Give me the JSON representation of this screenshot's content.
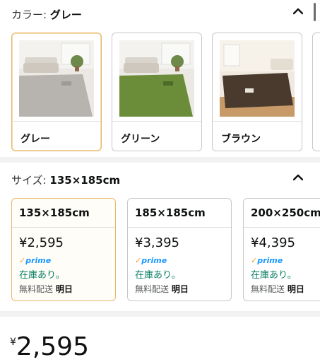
{
  "color_section": {
    "label": "カラー:",
    "selected_value": "グレー",
    "options": [
      {
        "label": "グレー",
        "rug_color": "#b7b4b0"
      },
      {
        "label": "グリーン",
        "rug_color": "#6b8d3a"
      },
      {
        "label": "ブラウン",
        "rug_color": "#4a3a2e"
      }
    ]
  },
  "size_section": {
    "label": "サイズ:",
    "selected_value": "135×185cm",
    "options": [
      {
        "size": "135×185cm",
        "price": "¥2,595",
        "prime": "prime",
        "stock": "在庫あり。",
        "ship_prefix": "無料配送",
        "ship_day": "明日"
      },
      {
        "size": "185×185cm",
        "price": "¥3,395",
        "prime": "prime",
        "stock": "在庫あり。",
        "ship_prefix": "無料配送",
        "ship_day": "明日"
      },
      {
        "size": "200×250cm",
        "price": "¥4,395",
        "prime": "prime",
        "stock": "在庫あり。",
        "ship_prefix": "無料配送",
        "ship_day": "明日"
      }
    ]
  },
  "price": {
    "currency": "¥",
    "amount": "2,595"
  },
  "colors": {
    "selected_border": "#e8b86a",
    "stock_green": "#067d62",
    "prime_blue": "#1a98ff"
  }
}
